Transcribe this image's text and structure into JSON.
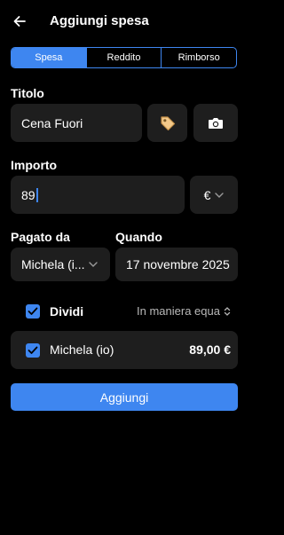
{
  "header": {
    "title": "Aggiungi spesa",
    "back_icon": "arrow-left-icon"
  },
  "tabs": [
    {
      "label": "Spesa",
      "active": true
    },
    {
      "label": "Reddito",
      "active": false
    },
    {
      "label": "Rimborso",
      "active": false
    }
  ],
  "form": {
    "title_label": "Titolo",
    "title_value": "Cena Fuori",
    "tag_icon": "tag-icon",
    "camera_icon": "camera-icon",
    "amount_label": "Importo",
    "amount_value": "89",
    "currency_symbol": "€",
    "paid_by_label": "Pagato da",
    "paid_by_value": "Michela (i...",
    "when_label": "Quando",
    "when_value": "17 novembre 2025"
  },
  "split": {
    "checked": true,
    "label": "Dividi",
    "mode": "In maniera equa",
    "participants": [
      {
        "name": "Michela (io)",
        "amount": "89,00 €",
        "checked": true
      }
    ]
  },
  "submit_label": "Aggiungi",
  "colors": {
    "accent": "#3e86f0",
    "background": "#000000",
    "field": "#1e1e1e"
  }
}
